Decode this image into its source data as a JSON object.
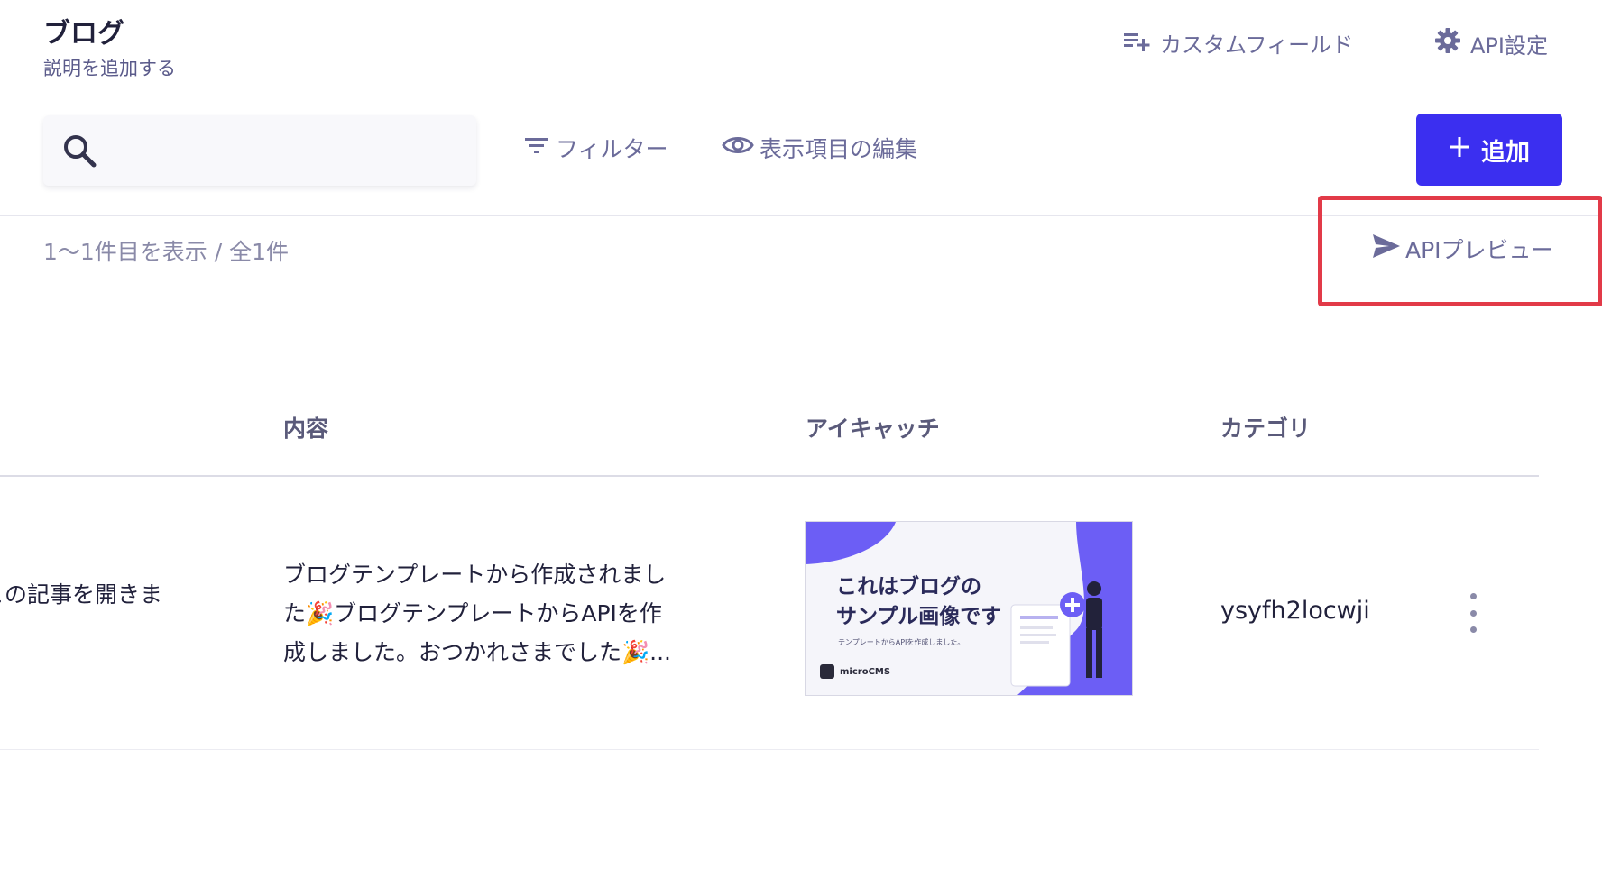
{
  "header": {
    "title": "ブログ",
    "description": "説明を追加する",
    "custom_field_label": "カスタムフィールド",
    "api_settings_label": "API設定"
  },
  "toolbar": {
    "search_value": "",
    "filter_label": "フィルター",
    "columns_label": "表示項目の編集",
    "add_label": "追加"
  },
  "list": {
    "count_text": "1〜1件目を表示 / 全1件",
    "api_preview_label": "APIプレビュー"
  },
  "table": {
    "columns": [
      "内容",
      "アイキャッチ",
      "カテゴリ"
    ],
    "rows": [
      {
        "title": "この記事を開きま",
        "content_lines": [
          "ブログテンプレートから作成されまし",
          "た🎉ブログテンプレートからAPIを作",
          "成しました。おつかれさまでした🎉..."
        ],
        "eyecatch": {
          "line1": "これはブログの",
          "line2": "サンプル画像です",
          "small_text": "テンプレートからAPIを作成しました。",
          "logo_text": "microCMS"
        },
        "category": "ysyfh2locwji"
      }
    ]
  },
  "colors": {
    "accent": "#3b2ff0",
    "highlight": "#e23a48",
    "muted_text": "#6b6b9a"
  },
  "icons": {
    "custom_field": "playlist-add-icon",
    "api_settings": "gear-icon",
    "search": "search-icon",
    "filter": "filter-icon",
    "columns": "eye-icon",
    "add": "plus-icon",
    "api_preview": "send-icon",
    "row_menu": "more-vertical-icon"
  }
}
